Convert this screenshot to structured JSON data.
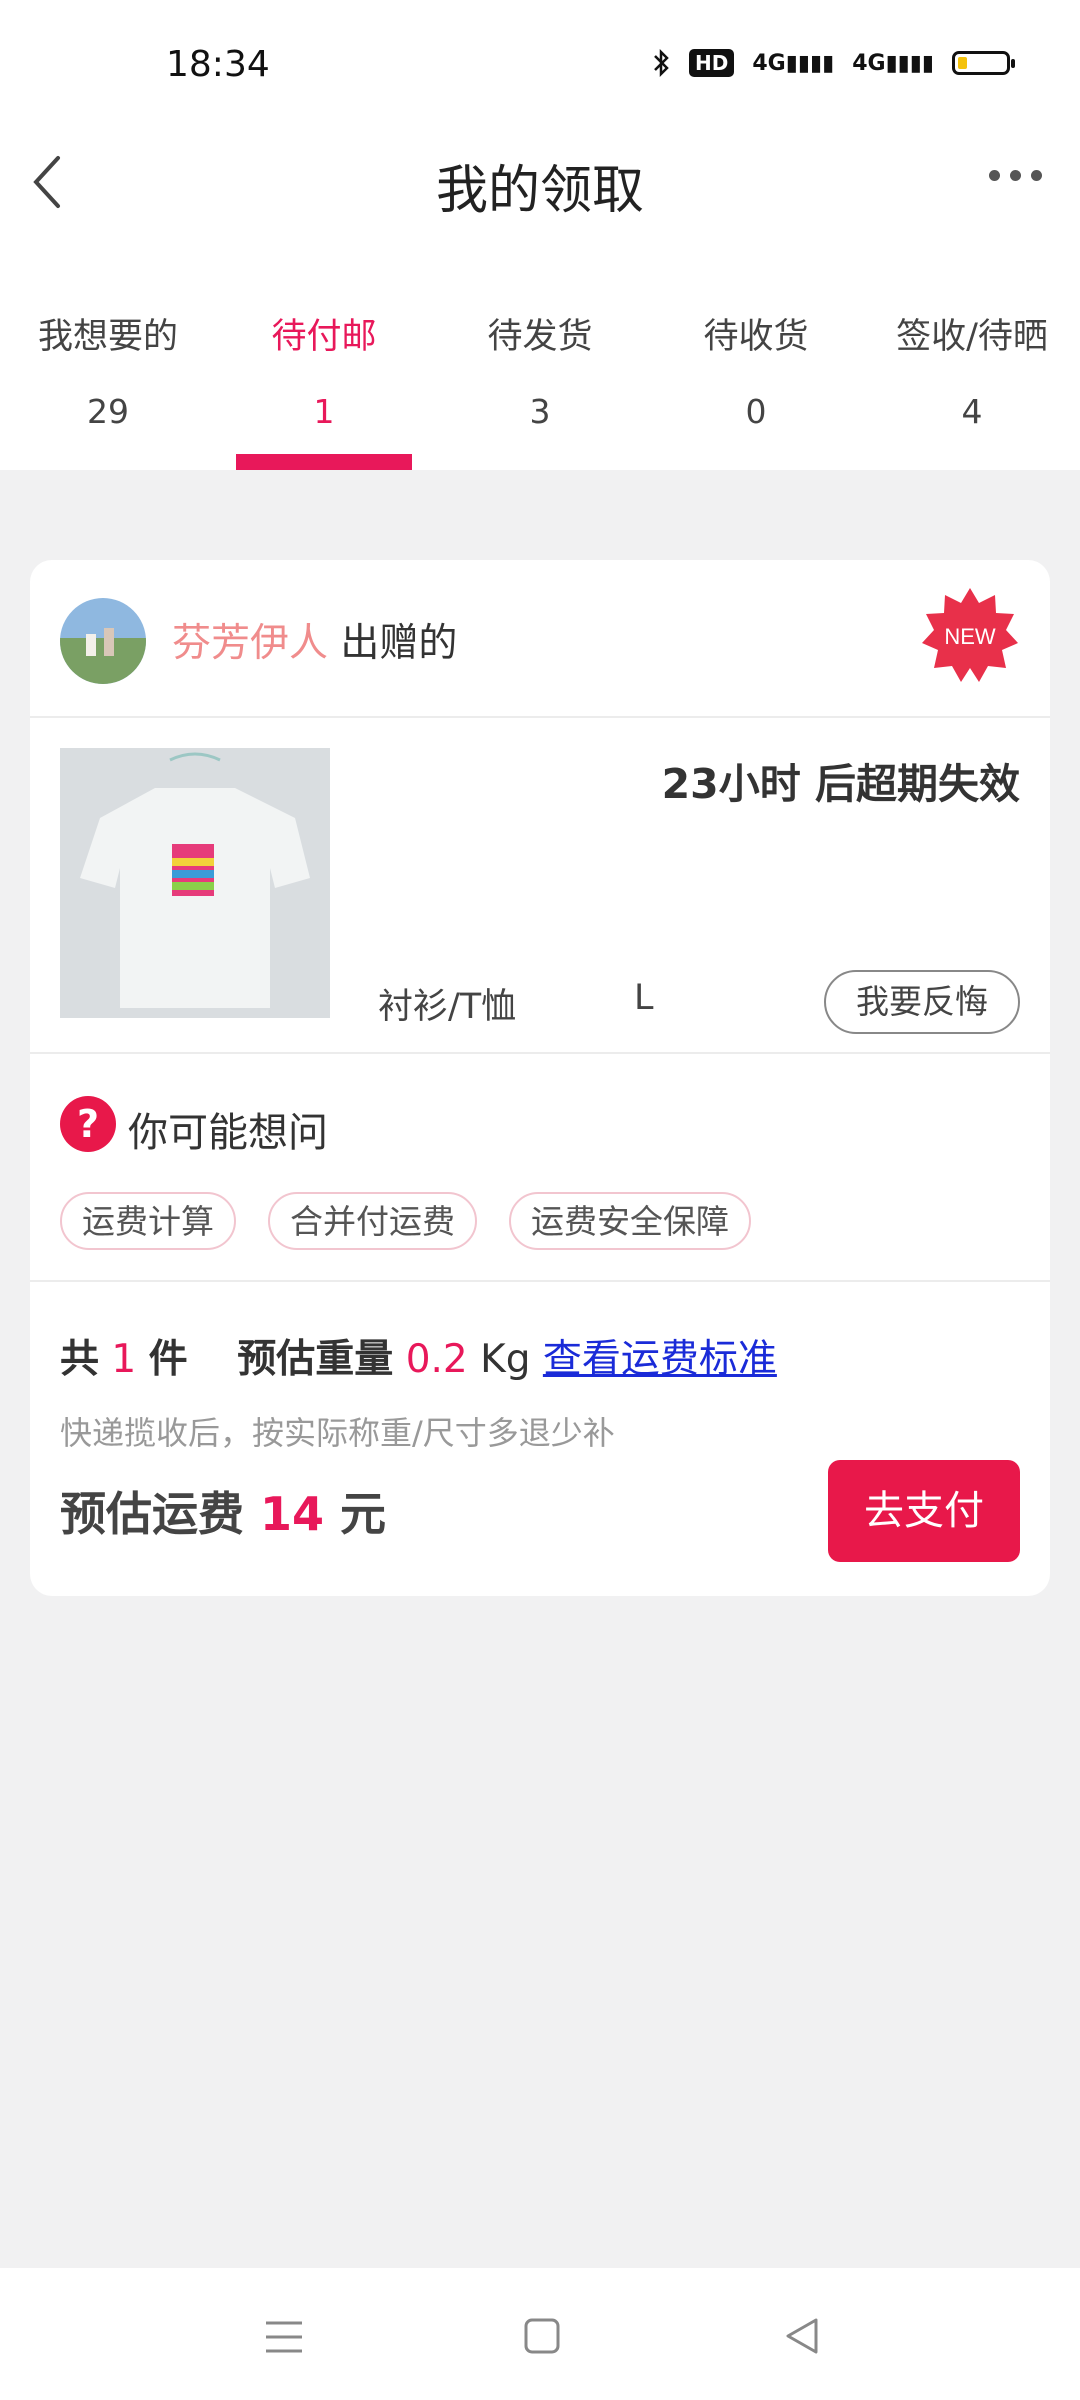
{
  "status_bar": {
    "time": "18:34",
    "icons": [
      "bluetooth-icon",
      "hd-icon",
      "signal-4g-icon",
      "signal-4g-icon",
      "battery-icon"
    ],
    "hd": "HD",
    "net1": "4G",
    "net2": "4G",
    "battery_level": 0.2
  },
  "nav": {
    "title": "我的领取",
    "back_icon": "chevron-left-icon",
    "more_icon": "more-dots-icon"
  },
  "tabs": [
    {
      "label": "我想要的",
      "count": "29",
      "active": false
    },
    {
      "label": "待付邮",
      "count": "1",
      "active": true
    },
    {
      "label": "待发货",
      "count": "3",
      "active": false
    },
    {
      "label": "待收货",
      "count": "0",
      "active": false
    },
    {
      "label": "签收/待晒",
      "count": "4",
      "active": false
    }
  ],
  "card": {
    "giver_name": "芬芳伊人",
    "giver_suffix": "出赠的",
    "new_badge": "NEW",
    "expire_text": "23小时 后超期失效",
    "category": "衬衫/T恤",
    "size": "L",
    "regret_button": "我要反悔",
    "faq_title": "你可能想问",
    "faq_icon": "question-icon",
    "chips": [
      "运费计算",
      "合并付运费",
      "运费安全保障"
    ],
    "summary": {
      "prefix": "共",
      "count": "1",
      "count_unit": "件",
      "weight_label": "预估重量",
      "weight": "0.2",
      "weight_unit": "Kg",
      "link": "查看运费标准"
    },
    "note": "快递揽收后，按实际称重/尺寸多退少补",
    "fee_label": "预估运费",
    "fee_value": "14",
    "fee_unit": "元",
    "pay_button": "去支付"
  },
  "colors": {
    "accent": "#e8185a",
    "giver_name": "#f08c8c",
    "link": "#1a2bd8",
    "background": "#f1f1f2"
  },
  "bottom_nav": [
    "menu-icon",
    "home-icon",
    "back-triangle-icon"
  ]
}
